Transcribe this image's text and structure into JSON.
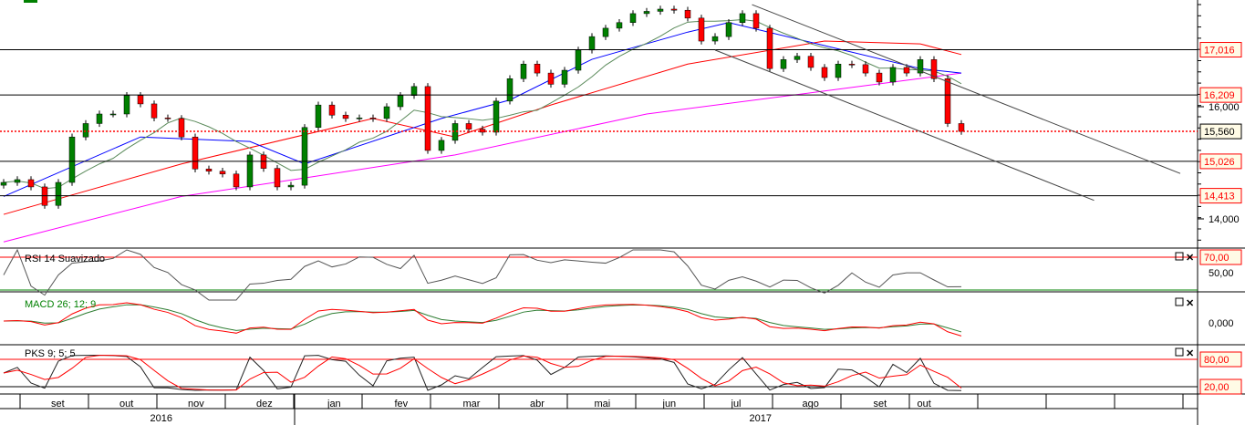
{
  "chart_data": {
    "type": "candlestick",
    "price_axis": {
      "ticks": [
        16000,
        14000
      ],
      "tick_labels": [
        "16,000",
        "14,000"
      ],
      "range": [
        13480,
        17900
      ]
    },
    "closes": [
      14650,
      14700,
      14570,
      14240,
      14650,
      15460,
      15700,
      15870,
      15870,
      16200,
      16050,
      15800,
      15790,
      15460,
      14890,
      14850,
      14800,
      14570,
      15140,
      14900,
      14570,
      14600,
      15630,
      16030,
      15850,
      15790,
      15800,
      15790,
      16000,
      16200,
      16360,
      15220,
      15400,
      15700,
      15600,
      15545,
      16100,
      16500,
      16760,
      16600,
      16400,
      16650,
      17010,
      17250,
      17400,
      17500,
      17660,
      17700,
      17740,
      17720,
      17580,
      17170,
      17250,
      17500,
      17660,
      17400,
      16680,
      16840,
      16900,
      16700,
      16520,
      16760,
      16750,
      16600,
      16440,
      16700,
      16600,
      16840,
      16500,
      15700,
      15560
    ],
    "moving_averages": [
      {
        "name": "ma-magenta",
        "color": "#ff00ff",
        "points": [
          [
            0,
            13590
          ],
          [
            13,
            14400
          ],
          [
            22,
            14730
          ],
          [
            33,
            15140
          ],
          [
            47,
            15870
          ],
          [
            60,
            16280
          ],
          [
            70,
            16600
          ]
        ]
      },
      {
        "name": "ma-red",
        "color": "#ff0000",
        "points": [
          [
            0,
            14080
          ],
          [
            13,
            14980
          ],
          [
            27,
            15790
          ],
          [
            33,
            15460
          ],
          [
            40,
            16030
          ],
          [
            50,
            16760
          ],
          [
            60,
            17170
          ],
          [
            67,
            17120
          ],
          [
            70,
            16930
          ]
        ]
      },
      {
        "name": "ma-blue",
        "color": "#0000ff",
        "points": [
          [
            0,
            14400
          ],
          [
            10,
            15460
          ],
          [
            18,
            15380
          ],
          [
            22,
            14980
          ],
          [
            32,
            15790
          ],
          [
            37,
            16120
          ],
          [
            43,
            16845
          ],
          [
            50,
            17330
          ],
          [
            53,
            17500
          ],
          [
            60,
            17090
          ],
          [
            67,
            16680
          ],
          [
            70,
            16600
          ]
        ]
      }
    ],
    "short_ma_period": 9,
    "levels": [
      {
        "value": 17016,
        "label": "17,016"
      },
      {
        "value": 16209,
        "label": "16,209"
      },
      {
        "value": 15026,
        "label": "15,026"
      },
      {
        "value": 14413,
        "label": "14,413"
      }
    ],
    "last_price": {
      "value": 15560,
      "label": "15,560"
    },
    "trend_lines": [
      [
        [
          54.7,
          17820
        ],
        [
          86,
          14810
        ]
      ],
      [
        [
          52,
          17010
        ],
        [
          79.7,
          14330
        ]
      ]
    ],
    "indicators": {
      "rsi": {
        "title": "RSI 14 Suavizado",
        "level_label": "70,00",
        "mid_label": "50,00",
        "period": 14
      },
      "macd": {
        "title": "MACD 26; 12; 9",
        "zero_label": "0,000"
      },
      "pks": {
        "title": "PKS 9; 5; 5",
        "upper_label": "80,00",
        "lower_label": "20,00"
      }
    },
    "x_axis": {
      "months": [
        {
          "label": "set",
          "i": 4
        },
        {
          "label": "out",
          "i": 9
        },
        {
          "label": "nov",
          "i": 14
        },
        {
          "label": "dez",
          "i": 19
        },
        {
          "label": "jan",
          "i": 24.2
        },
        {
          "label": "fev",
          "i": 29.1
        },
        {
          "label": "mar",
          "i": 34.1
        },
        {
          "label": "abr",
          "i": 39
        },
        {
          "label": "mai",
          "i": 43.7
        },
        {
          "label": "jun",
          "i": 48.7
        },
        {
          "label": "jul",
          "i": 53.7
        },
        {
          "label": "ago",
          "i": 58.9
        },
        {
          "label": "set",
          "i": 64.1
        },
        {
          "label": "out",
          "i": 67.3
        }
      ],
      "years": [
        {
          "label": "2016",
          "i": 10.7
        },
        {
          "label": "2017",
          "i": 54.5
        }
      ]
    },
    "colors": {
      "up": "#008000",
      "down": "#ff0000",
      "level": "#000000",
      "last": "#ff0000",
      "label_bg": "#fffbe6"
    }
  }
}
